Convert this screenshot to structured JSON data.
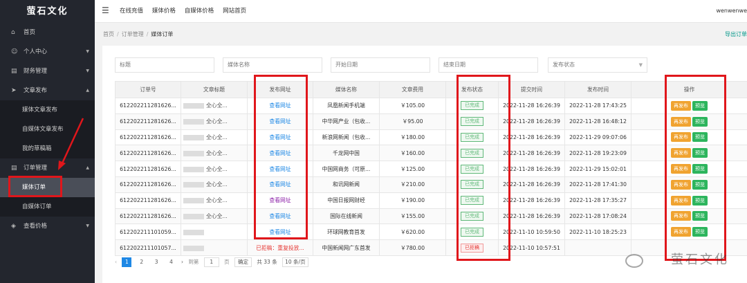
{
  "brand": {
    "logo": "萤石文化"
  },
  "sidebar": {
    "items": [
      {
        "label": "首页",
        "icon": "home-icon"
      },
      {
        "label": "个人中心",
        "icon": "user-icon"
      },
      {
        "label": "财务管理",
        "icon": "finance-icon"
      },
      {
        "label": "文章发布",
        "icon": "send-icon"
      },
      {
        "label": "订单管理",
        "icon": "list-icon"
      },
      {
        "label": "查看价格",
        "icon": "tag-icon"
      }
    ],
    "article_sub": [
      "媒体文章发布",
      "自媒体文章发布",
      "我的草稿箱"
    ],
    "order_sub": [
      "媒体订单",
      "自媒体订单"
    ]
  },
  "topbar": {
    "links": [
      "在线充值",
      "媒体价格",
      "自媒体价格",
      "网站首页"
    ],
    "user": "wenwenwe"
  },
  "breadcrumb": {
    "home": "首页",
    "parent": "订单管理",
    "current": "媒体订单",
    "export": "导出订单"
  },
  "filters": {
    "title": "标题",
    "media": "媒体名称",
    "start": "开始日期",
    "end": "结束日期",
    "status": "发布状态"
  },
  "table": {
    "headers": [
      "订单号",
      "文章标题",
      "发布网址",
      "媒体名称",
      "文章费用",
      "发布状态",
      "提交时间",
      "发布时间",
      "操作"
    ],
    "rows": [
      {
        "order": "612202211281626...",
        "title": "全心全...",
        "url": "查看网址",
        "media": "凤凰新闻手机端",
        "fee": "￥105.00",
        "status": "已完成",
        "submit": "2022-11-28 16:26:39",
        "publish": "2022-11-28 17:43:25"
      },
      {
        "order": "612202211281626...",
        "title": "全心全...",
        "url": "查看网址",
        "media": "中华网产业（包收...",
        "fee": "￥95.00",
        "status": "已完成",
        "submit": "2022-11-28 16:26:39",
        "publish": "2022-11-28 16:48:12"
      },
      {
        "order": "612202211281626...",
        "title": "全心全...",
        "url": "查看网址",
        "media": "新浪网新闻（包收...",
        "fee": "￥180.00",
        "status": "已完成",
        "submit": "2022-11-28 16:26:39",
        "publish": "2022-11-29 09:07:06"
      },
      {
        "order": "612202211281626...",
        "title": "全心全...",
        "url": "查看网址",
        "media": "千龙网中国",
        "fee": "￥160.00",
        "status": "已完成",
        "submit": "2022-11-28 16:26:39",
        "publish": "2022-11-28 19:23:09"
      },
      {
        "order": "612202211281626...",
        "title": "全心全...",
        "url": "查看网址",
        "media": "中国网商务（可原...",
        "fee": "￥125.00",
        "status": "已完成",
        "submit": "2022-11-28 16:26:39",
        "publish": "2022-11-29 15:02:01"
      },
      {
        "order": "612202211281626...",
        "title": "全心全...",
        "url": "查看网址",
        "media": "和讯网新闻",
        "fee": "￥210.00",
        "status": "已完成",
        "submit": "2022-11-28 16:26:39",
        "publish": "2022-11-28 17:41:30"
      },
      {
        "order": "612202211281626...",
        "title": "全心全...",
        "url": "查看网址",
        "media": "中国日报网财经",
        "fee": "￥190.00",
        "status": "已完成",
        "submit": "2022-11-28 16:26:39",
        "publish": "2022-11-28 17:35:27"
      },
      {
        "order": "612202211281626...",
        "title": "全心全...",
        "url": "查看网址",
        "media": "国际在线新闻",
        "fee": "￥155.00",
        "status": "已完成",
        "submit": "2022-11-28 16:26:39",
        "publish": "2022-11-28 17:08:24"
      },
      {
        "order": "612202211101059...",
        "title": "",
        "url": "查看网址",
        "media": "环球网教育首发",
        "fee": "￥620.00",
        "status": "已完成",
        "submit": "2022-11-10 10:59:50",
        "publish": "2022-11-10 18:25:23"
      },
      {
        "order": "612202211101057...",
        "title": "",
        "url": "已拒稿：重复投放...",
        "media": "中国新闻网广东首发",
        "fee": "￥780.00",
        "status": "已拒稿",
        "submit": "2022-11-10 10:57:51",
        "publish": ""
      }
    ],
    "actions": {
      "republish": "再发布",
      "preview": "预览"
    }
  },
  "pager": {
    "pages": [
      "1",
      "2",
      "3",
      "4"
    ],
    "goto": "到第",
    "page_value": "1",
    "page_unit": "页",
    "confirm": "确定",
    "total": "共 33 条",
    "per_page": "10 条/页"
  },
  "watermark": "萤石文化",
  "colors": {
    "sidebar": "#23262e",
    "accent": "#1e88e5",
    "success": "#5fb878",
    "orange": "#f0a330",
    "green": "#2db55d",
    "annotation": "#e0161b"
  }
}
